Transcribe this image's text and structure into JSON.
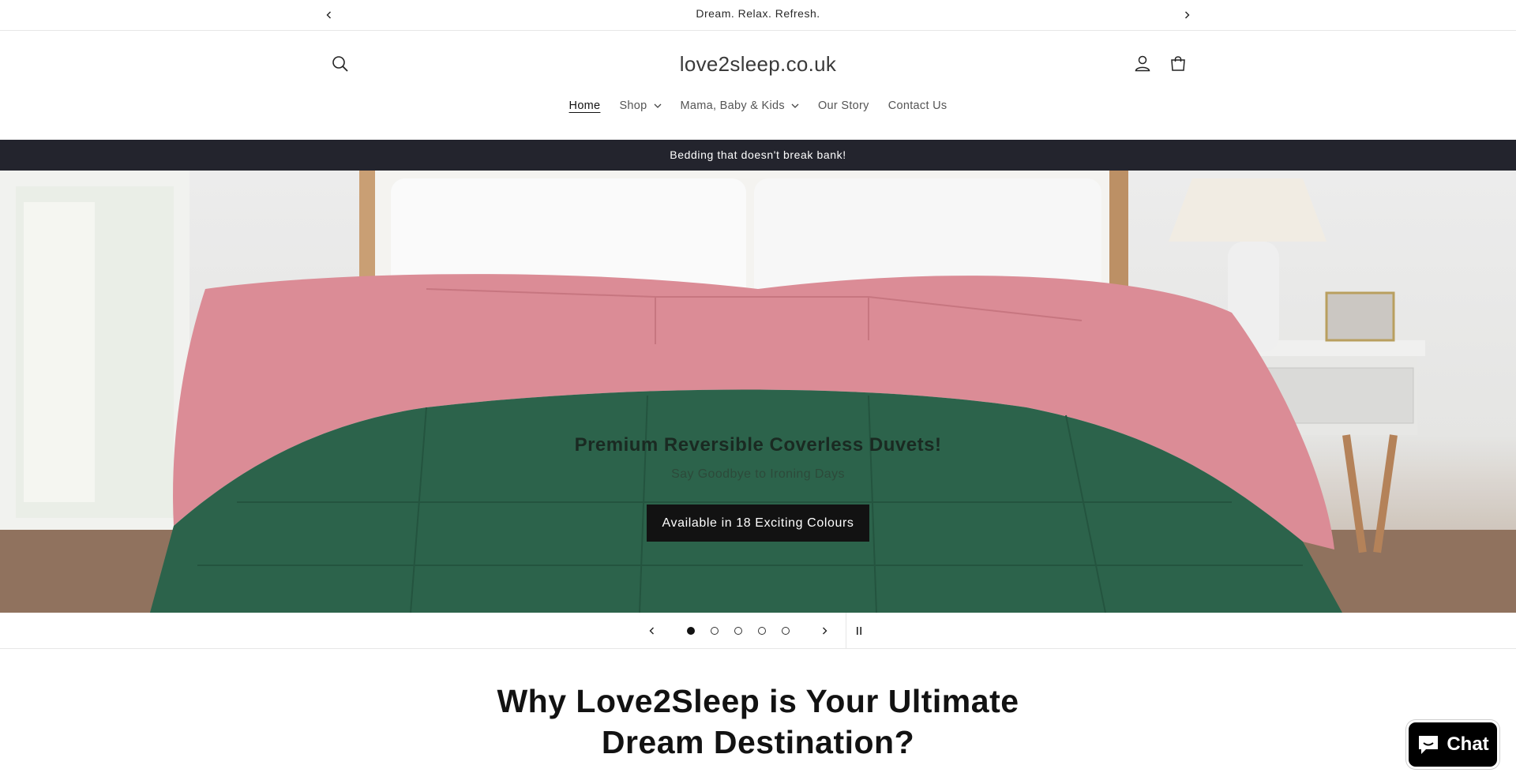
{
  "announcement": {
    "text": "Dream. Relax. Refresh."
  },
  "header": {
    "logo": "love2sleep.co.uk",
    "icons": [
      "search-icon",
      "account-icon",
      "cart-icon"
    ]
  },
  "nav": {
    "items": [
      {
        "label": "Home",
        "active": true,
        "dropdown": false
      },
      {
        "label": "Shop",
        "active": false,
        "dropdown": true
      },
      {
        "label": "Mama, Baby & Kids",
        "active": false,
        "dropdown": true
      },
      {
        "label": "Our Story",
        "active": false,
        "dropdown": false
      },
      {
        "label": "Contact Us",
        "active": false,
        "dropdown": false
      }
    ]
  },
  "promo": {
    "text": "Bedding that doesn't break bank!"
  },
  "hero": {
    "title": "Premium Reversible Coverless Duvets!",
    "subtitle": "Say Goodbye to Ironing Days",
    "button_label": "Available in 18 Exciting Colours"
  },
  "slider": {
    "slide_count": 5,
    "active_index": 0
  },
  "section": {
    "heading": "Why Love2Sleep is Your Ultimate Dream Destination?"
  },
  "chat": {
    "label": "Chat"
  },
  "colors": {
    "promo_bg": "#23242d",
    "button_bg": "#121212",
    "duvet_pink": "#d98590",
    "duvet_green": "#1f5a40"
  }
}
